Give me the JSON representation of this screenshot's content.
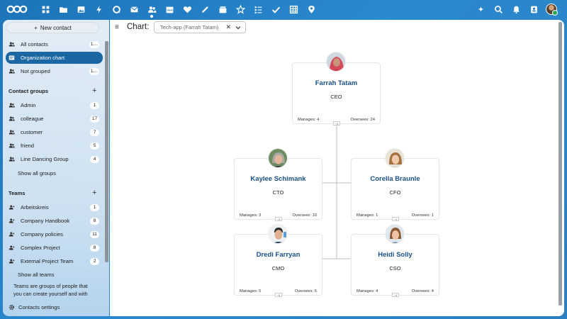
{
  "topbar": {
    "apps": [
      "dashboard-icon",
      "files-icon",
      "photos-icon",
      "activity-icon",
      "talk-icon",
      "mail-icon",
      "contacts-icon",
      "calendar-icon",
      "heart-icon",
      "notes-icon",
      "deck-icon",
      "star-icon",
      "tasks-icon",
      "check-icon",
      "tables-icon",
      "maps-icon"
    ],
    "right": [
      "assistant-icon",
      "search-icon",
      "notifications-icon",
      "contacts-menu-icon"
    ]
  },
  "sidebar": {
    "new_contact": "New contact",
    "main_items": [
      {
        "label": "All contacts",
        "count": "1…"
      },
      {
        "label": "Organization chart",
        "count": ""
      },
      {
        "label": "Not grouped",
        "count": "1…"
      }
    ],
    "groups_title": "Contact groups",
    "groups": [
      {
        "label": "Admin",
        "count": "1"
      },
      {
        "label": "colleague",
        "count": "17"
      },
      {
        "label": "customer",
        "count": "7"
      },
      {
        "label": "friend",
        "count": "5"
      },
      {
        "label": "Line Dancing Group",
        "count": "4"
      }
    ],
    "show_all_groups": "Show all groups",
    "teams_title": "Teams",
    "teams": [
      {
        "label": "Arbeitskreis",
        "count": "1"
      },
      {
        "label": "Company Handbook",
        "count": "8"
      },
      {
        "label": "Company policies",
        "count": "11"
      },
      {
        "label": "Complex Project",
        "count": "8"
      },
      {
        "label": "External Project Team",
        "count": "2"
      }
    ],
    "show_all_teams": "Show all teams",
    "teams_description": "Teams are groups of people that you can create yourself and with",
    "settings": "Contacts settings"
  },
  "main": {
    "chart_label": "Chart:",
    "chart_select": "Tech-app (Farrah Tatam)"
  },
  "org": {
    "ceo": {
      "name": "Farrah Tatam",
      "role": "CEO",
      "manages": "Manages: 4",
      "oversees": "Oversees: 24",
      "knob": "−4"
    },
    "cto": {
      "name": "Kaylee Schimank",
      "role": "CTO",
      "manages": "Manages: 3",
      "oversees": "Oversees: 10",
      "knob": "−3"
    },
    "cfo": {
      "name": "Corella Braunle",
      "role": "CFO",
      "manages": "Manages: 1",
      "oversees": "Oversees: 1",
      "knob": "−1"
    },
    "cmo": {
      "name": "Dredi Farryan",
      "role": "CMO",
      "manages": "Manages: 5",
      "oversees": "Oversees: 5",
      "knob": "−5"
    },
    "cso": {
      "name": "Heidi Solly",
      "role": "CSO",
      "manages": "Manages: 4",
      "oversees": "Oversees: 4",
      "knob": "−4"
    }
  }
}
